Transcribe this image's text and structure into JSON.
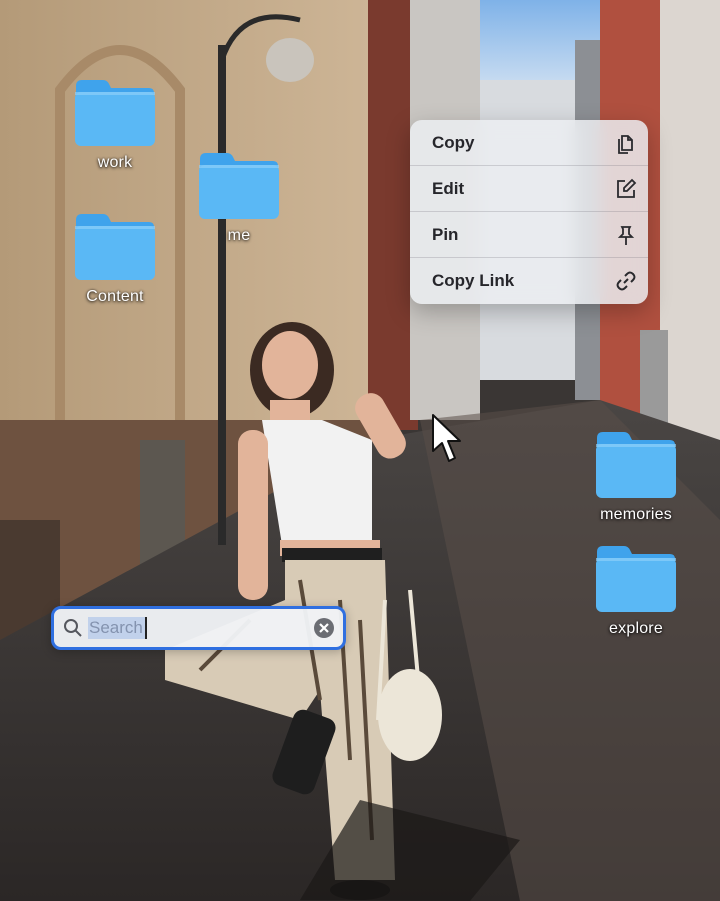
{
  "desktop": {
    "folders": [
      {
        "label": "work"
      },
      {
        "label": "me"
      },
      {
        "label": "Content"
      },
      {
        "label": "memories"
      },
      {
        "label": "explore"
      }
    ],
    "folder_color": "#5ab8f5",
    "folder_tab_color": "#3fa3ec"
  },
  "context_menu": {
    "items": [
      {
        "label": "Copy",
        "icon": "copy-icon"
      },
      {
        "label": "Edit",
        "icon": "edit-icon"
      },
      {
        "label": "Pin",
        "icon": "pin-icon"
      },
      {
        "label": "Copy Link",
        "icon": "link-icon"
      }
    ]
  },
  "search": {
    "placeholder": "Search",
    "value": "",
    "accent": "#2f6fe0"
  }
}
